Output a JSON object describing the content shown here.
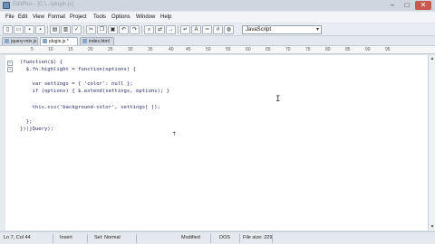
{
  "window": {
    "title": "EditPlus - [C:\\...\\plugin.js]"
  },
  "menu": [
    "File",
    "Edit",
    "View",
    "Format",
    "Project",
    "Tools",
    "Options",
    "Window",
    "Help"
  ],
  "toolbar": {
    "syntax_selected": "JavaScript"
  },
  "tabs": [
    {
      "label": "jquery-min.js"
    },
    {
      "label": "plugin.js *"
    },
    {
      "label": "index.html"
    }
  ],
  "ruler": {
    "ticks": [
      "5",
      "10",
      "15",
      "20",
      "25",
      "30",
      "35",
      "40",
      "45",
      "50",
      "55",
      "60",
      "65",
      "70",
      "75",
      "80",
      "85",
      "90",
      "95"
    ]
  },
  "code": [
    "(function($) {",
    "  $.fn.highlight = function(options) {",
    "",
    "    var settings = { 'color': null };",
    "    if (options) { $.extend(settings, options); }",
    "",
    "    this.css('background-color', settings[ ]);",
    "",
    "  };",
    "})(jQuery);"
  ],
  "status": {
    "position": "Ln 7, Col 44",
    "mode": "Insert",
    "selection": "Sel: Normal",
    "modified": "Modified",
    "line_ending": "DOS",
    "file_size": "File size: 229"
  },
  "icons": {
    "cursor": "up-arrow-cursor-icon",
    "mouse": "ibeam-icon"
  }
}
